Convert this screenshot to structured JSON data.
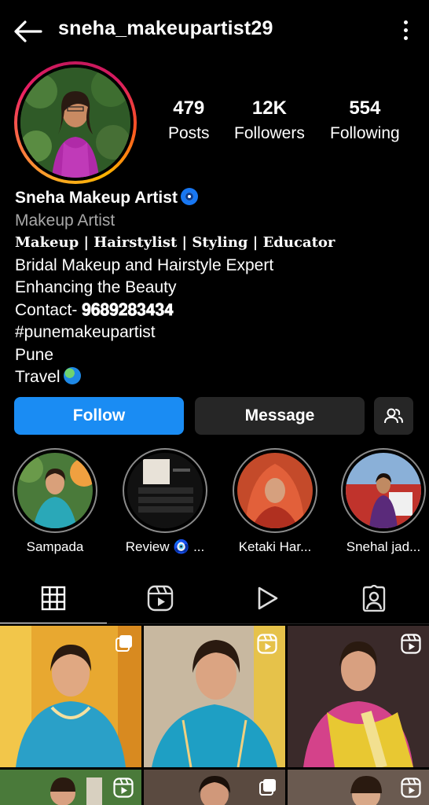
{
  "header": {
    "username": "sneha_makeupartist29",
    "back_icon": "arrow-left-icon",
    "menu_icon": "more-vertical-icon"
  },
  "stats": {
    "posts": {
      "value": "479",
      "label": "Posts"
    },
    "followers": {
      "value": "12K",
      "label": "Followers"
    },
    "following": {
      "value": "554",
      "label": "Following"
    }
  },
  "bio": {
    "name": "Sneha Makeup Artist",
    "category": "Makeup Artist",
    "tagline": "𝐌𝐚𝐤𝐞𝐮𝐩 | 𝐇𝐚𝐢𝐫𝐬𝐭𝐲𝐥𝐢𝐬𝐭 | 𝐒𝐭𝐲𝐥𝐢𝐧𝐠 | 𝐄𝐝𝐮𝐜𝐚𝐭𝐨𝐫",
    "line1": "Bridal Makeup and Hairstyle Expert",
    "line2": "Enhancing the Beauty",
    "contact_prefix": "Contact- ",
    "contact_number": "𝟗𝟔𝟖𝟗𝟐𝟖𝟑𝟒𝟑𝟒",
    "hashtag": "#punemakeupartist",
    "city": "Pune",
    "travel": "Travel"
  },
  "actions": {
    "follow": "Follow",
    "message": "Message",
    "suggest_icon": "add-person-icon"
  },
  "highlights": [
    {
      "label": "Sampada"
    },
    {
      "label": "Review 🧿 ..."
    },
    {
      "label": "Ketaki Har..."
    },
    {
      "label": "Snehal jad..."
    }
  ],
  "tabs": [
    {
      "icon": "grid-icon",
      "active": true
    },
    {
      "icon": "reels-icon",
      "active": false
    },
    {
      "icon": "play-icon",
      "active": false
    },
    {
      "icon": "tagged-icon",
      "active": false
    }
  ],
  "colors": {
    "follow_button": "#1a8cf3",
    "secondary_button": "#262626",
    "muted_text": "#a8a8a8"
  }
}
